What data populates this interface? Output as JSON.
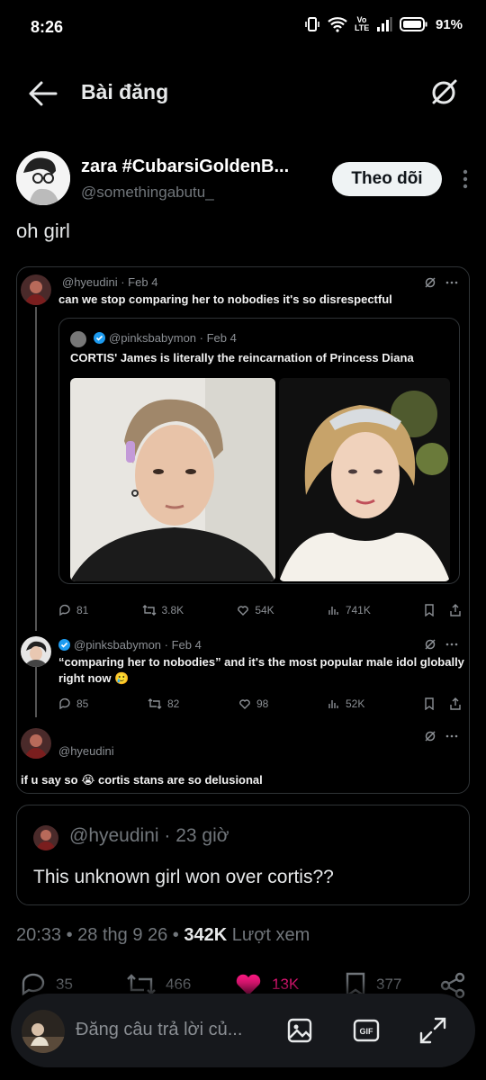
{
  "status_bar": {
    "time": "8:26",
    "network": "Vo LTE",
    "battery": "91%"
  },
  "header": {
    "title": "Bài đăng"
  },
  "author": {
    "name": "zara #CubarsiGoldenB...",
    "handle": "@somethingabutu_",
    "follow_label": "Theo dõi"
  },
  "post": {
    "text": "oh girl"
  },
  "embed": {
    "tweet1": {
      "meta": "@hyeudini · Feb 4",
      "text": "can we stop comparing her to nobodies it's so disrespectful",
      "quoted": {
        "meta": "@pinksbabymon · Feb 4",
        "text": "CORTIS' James is literally the reincarnation of Princess Diana"
      },
      "stats": {
        "replies": "81",
        "reposts": "3.8K",
        "likes": "54K",
        "views": "741K"
      }
    },
    "tweet2": {
      "meta": "@pinksbabymon · Feb 4",
      "text_line1": "“comparing her to nobodies” and it's the most popular male idol globally",
      "text_line2": "right now 🥲",
      "stats": {
        "replies": "85",
        "reposts": "82",
        "likes": "98",
        "views": "52K"
      }
    },
    "tweet3": {
      "meta": "@hyeudini",
      "text": "if u say so 😭 cortis stans are so delusional"
    }
  },
  "quote": {
    "meta": "@hyeudini · 23 giờ",
    "text": "This unknown girl won over cortis??"
  },
  "timestamp": {
    "time": "20:33 • 28 thg 9 26 • ",
    "views_count": "342K",
    "views_label": " Lượt xem"
  },
  "actions": {
    "replies": "35",
    "reposts": "466",
    "likes": "13K",
    "bookmarks": "377"
  },
  "composer": {
    "placeholder": "Đăng câu trả lời củ..."
  },
  "colors": {
    "like": "#f91880",
    "verified": "#1d9bf0",
    "follow_bg": "#eff3f4"
  }
}
